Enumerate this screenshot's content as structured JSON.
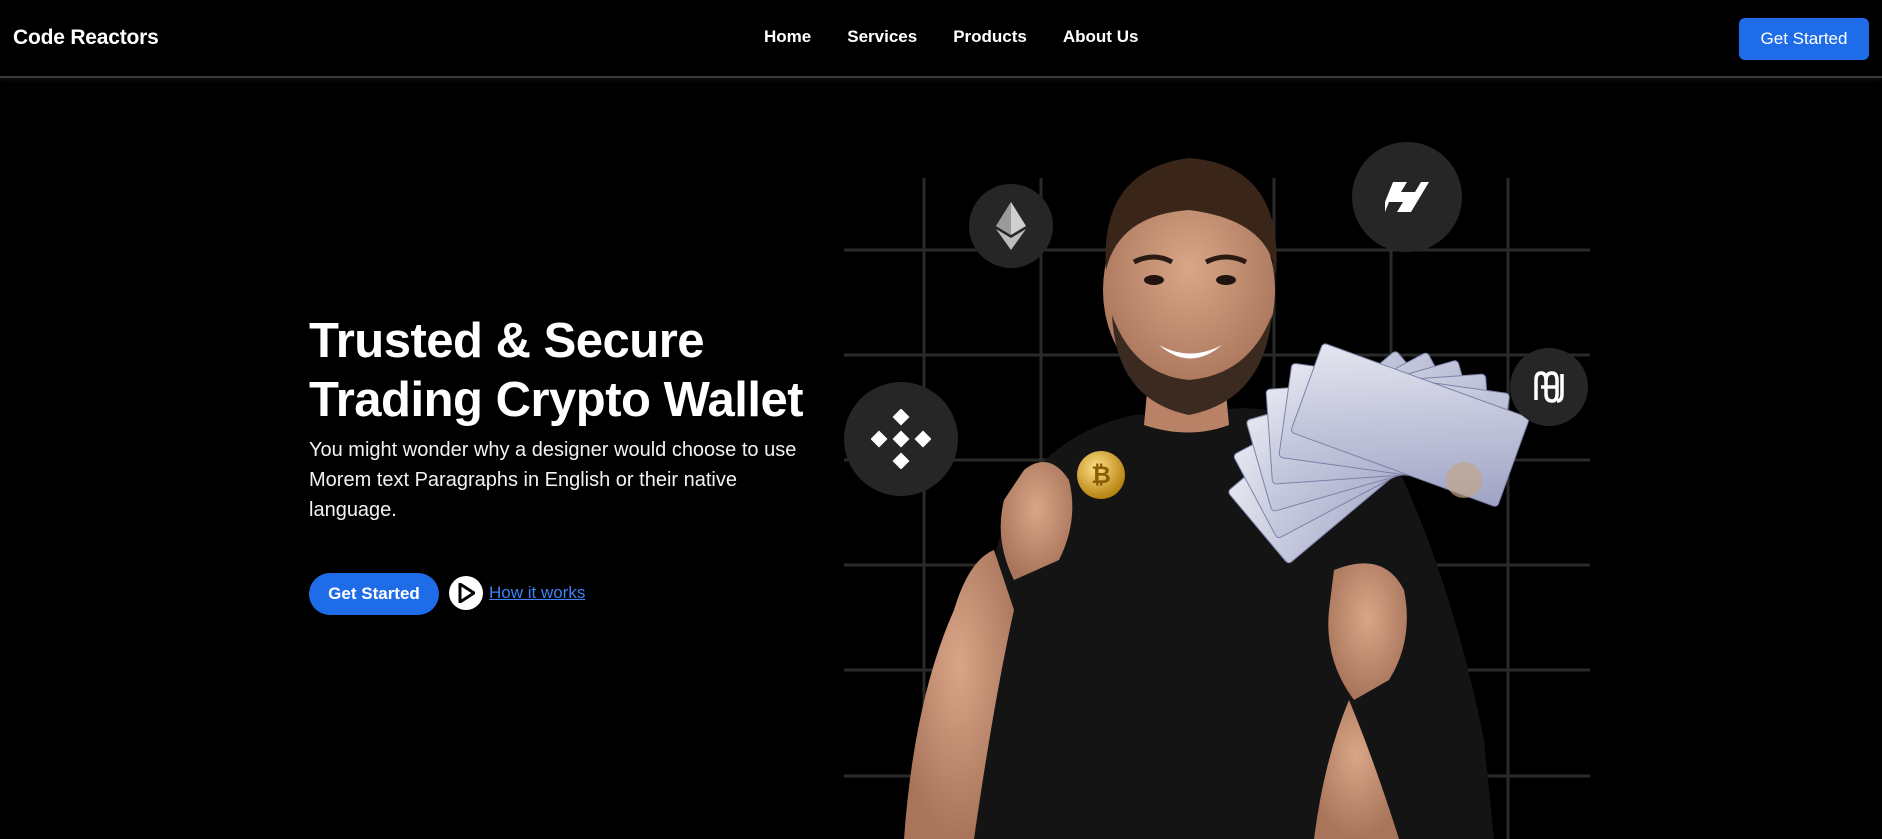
{
  "header": {
    "brand": "Code Reactors",
    "nav": [
      {
        "label": "Home"
      },
      {
        "label": "Services"
      },
      {
        "label": "Products"
      },
      {
        "label": "About Us"
      }
    ],
    "cta_label": "Get Started"
  },
  "hero": {
    "title_line1": "Trusted & Secure",
    "title_line2": "Trading Crypto Wallet",
    "subtitle": "You might wonder why a designer would choose to use Morem text Paragraphs in English or their native language.",
    "cta_label": "Get Started",
    "how_it_works_label": "How it works"
  },
  "visual": {
    "icons": [
      "ethereum-icon",
      "binance-icon",
      "horizen-icon",
      "harmony-icon",
      "play-icon"
    ],
    "accent_color": "#1f6ce8",
    "badge_color": "#262626"
  }
}
